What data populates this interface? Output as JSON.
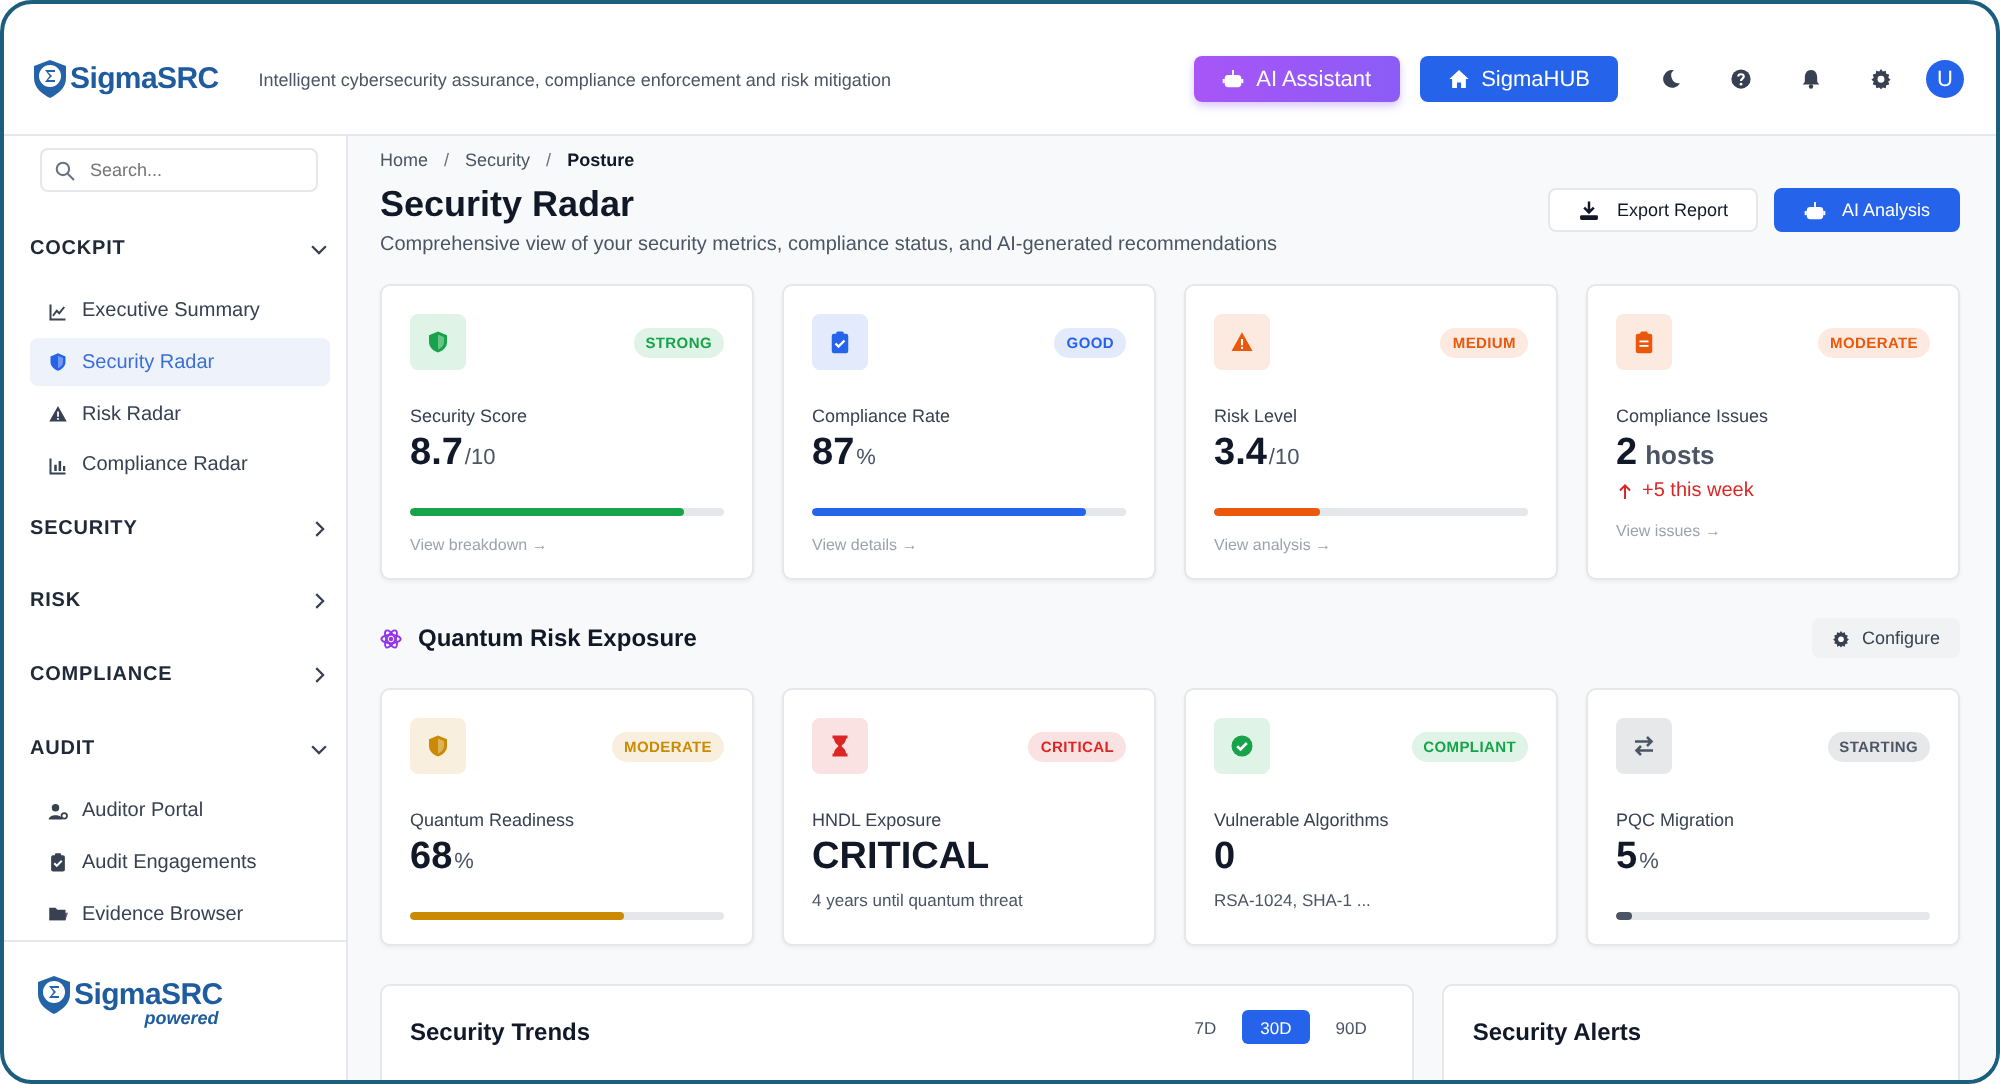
{
  "header": {
    "logo": "SigmaSRC",
    "tagline": "Intelligent cybersecurity assurance, compliance enforcement and risk mitigation",
    "buttons": [
      {
        "label": "AI Assistant",
        "kind": "purple"
      },
      {
        "label": "SigmaHUB",
        "kind": "blue"
      }
    ],
    "avatar": "U"
  },
  "sidebar": {
    "search": {
      "placeholder": "Search..."
    },
    "sections": [
      {
        "label": "COCKPIT",
        "expanded": true,
        "children": [
          {
            "label": "Executive Summary",
            "selected": false
          },
          {
            "label": "Security Radar",
            "selected": true
          },
          {
            "label": "Risk Radar",
            "selected": false
          },
          {
            "label": "Compliance Radar",
            "selected": false
          }
        ]
      },
      {
        "label": "SECURITY",
        "expanded": false
      },
      {
        "label": "RISK",
        "expanded": false
      },
      {
        "label": "COMPLIANCE",
        "expanded": false
      },
      {
        "label": "AUDIT",
        "expanded": true,
        "children": [
          {
            "label": "Auditor Portal",
            "selected": false
          },
          {
            "label": "Audit Engagements",
            "selected": false
          },
          {
            "label": "Evidence Browser",
            "selected": false
          }
        ]
      }
    ],
    "footer": {
      "logo": "SigmaSRC",
      "tag": "powered"
    }
  },
  "breadcrumb": [
    {
      "kind": "link",
      "text": "Home"
    },
    {
      "kind": "separator",
      "text": "/"
    },
    {
      "kind": "link",
      "text": "Security"
    },
    {
      "kind": "separator",
      "text": "/"
    },
    {
      "kind": "current",
      "text": "Posture"
    }
  ],
  "page": {
    "title": "Security Radar",
    "subtitle": "Comprehensive view of your security metrics, compliance status, and AI-generated recommendations",
    "actions": [
      {
        "label": "Export Report",
        "kind": "outline"
      },
      {
        "label": "AI Analysis",
        "kind": "primary"
      }
    ]
  },
  "metrics": [
    {
      "label": "Security Score",
      "value": "8.7",
      "unit": "/10",
      "badge": "STRONG",
      "color": "#16a34a",
      "level": 0.87,
      "link": "View breakdown →"
    },
    {
      "label": "Compliance Rate",
      "value": "87",
      "unit": "%",
      "badge": "GOOD",
      "color": "#2563eb",
      "level": 0.87,
      "link": "View details →"
    },
    {
      "label": "Risk Level",
      "value": "3.4",
      "unit": "/10",
      "badge": "MEDIUM",
      "color": "#ea580c",
      "level": 0.34,
      "link": "View analysis →"
    },
    {
      "label": "Compliance Issues",
      "value": "2",
      "unit": "hosts",
      "badge": "MODERATE",
      "color": "#ea580c",
      "trend": "+5 this week",
      "link": "View issues →"
    }
  ],
  "quantum": {
    "title": "Quantum Risk Exposure",
    "configure": "Configure",
    "cards": [
      {
        "label": "Quantum Readiness",
        "value": "68",
        "unit": "%",
        "badge": "MODERATE",
        "color": "#ca8a04",
        "level": 0.68
      },
      {
        "label": "HNDL Exposure",
        "value": "CRITICAL",
        "badge": "CRITICAL",
        "color": "#dc2626",
        "note": "4 years until quantum threat"
      },
      {
        "label": "Vulnerable Algorithms",
        "value": "0",
        "badge": "COMPLIANT",
        "color": "#16a34a",
        "note": "RSA-1024, SHA-1 ..."
      },
      {
        "label": "PQC Migration",
        "value": "5",
        "unit": "%",
        "badge": "STARTING",
        "color": "#4b5563",
        "level": 0.05
      }
    ]
  },
  "trends": {
    "title": "Security Trends",
    "ranges": [
      {
        "label": "7D",
        "selected": false
      },
      {
        "label": "30D",
        "selected": true
      },
      {
        "label": "90D",
        "selected": false
      }
    ]
  },
  "alerts": {
    "title": "Security Alerts"
  }
}
